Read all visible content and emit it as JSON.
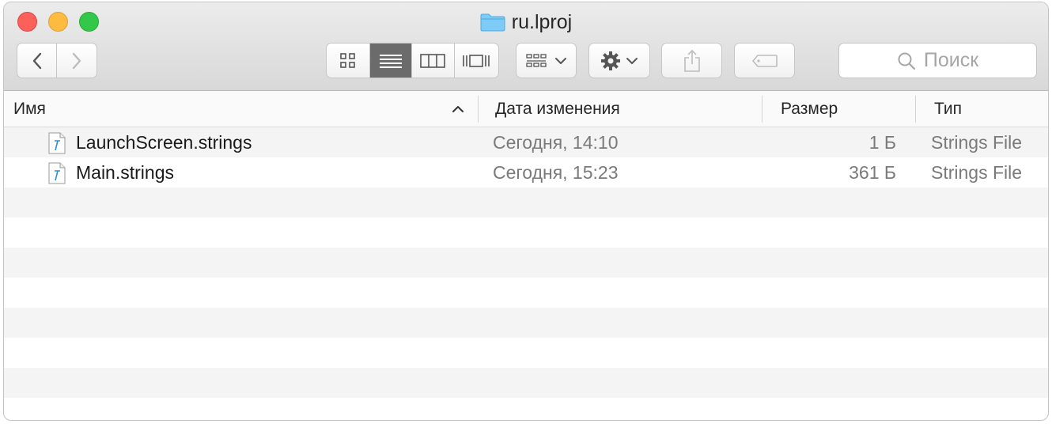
{
  "window": {
    "title": "ru.lproj"
  },
  "toolbar": {
    "back_icon": "chevron-left-icon",
    "forward_icon": "chevron-right-icon",
    "view_modes": [
      "icon-view",
      "list-view",
      "column-view",
      "cover-flow-view"
    ],
    "active_view": "list-view",
    "search_placeholder": "Поиск"
  },
  "columns": {
    "name": "Имя",
    "date": "Дата изменения",
    "size": "Размер",
    "kind": "Тип"
  },
  "files": [
    {
      "name": "LaunchScreen.strings",
      "date": "Сегодня, 14:10",
      "size": "1 Б",
      "kind": "Strings File"
    },
    {
      "name": "Main.strings",
      "date": "Сегодня, 15:23",
      "size": "361 Б",
      "kind": "Strings File"
    }
  ],
  "colors": {
    "close": "#fc605b",
    "minimize": "#fdbc40",
    "maximize": "#34c84a",
    "folder": "#5ac8fa"
  }
}
